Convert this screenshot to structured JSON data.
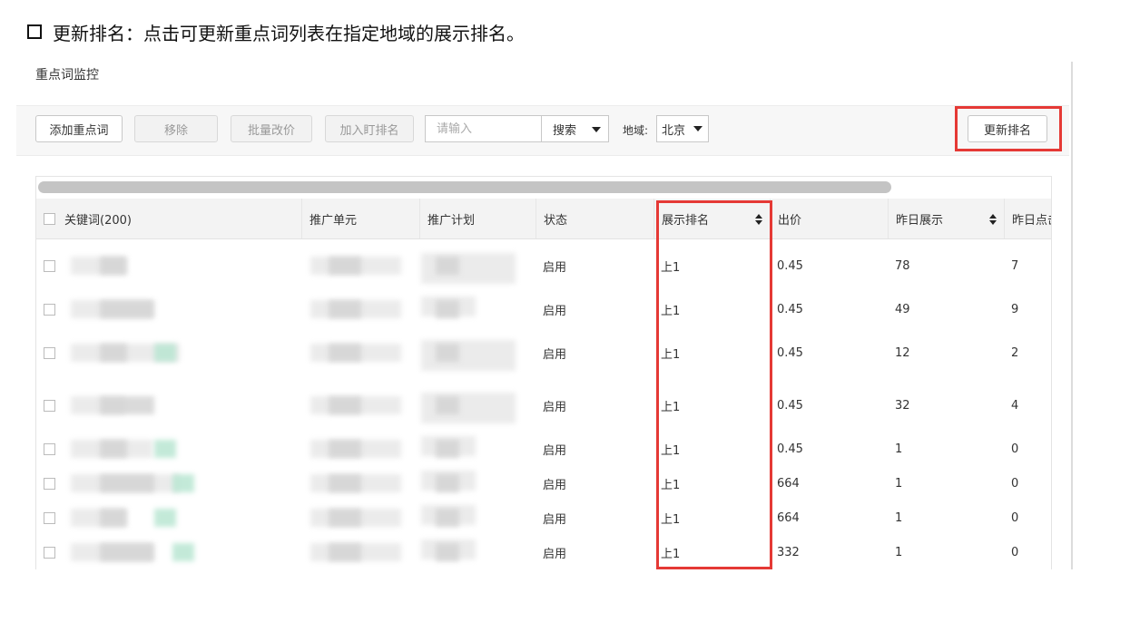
{
  "caption": "更新排名：点击可更新重点词列表在指定地域的展示排名。",
  "panel_title": "重点词监控",
  "toolbar": {
    "add_label": "添加重点词",
    "remove_label": "移除",
    "batch_price_label": "批量改价",
    "watch_rank_label": "加入盯排名",
    "search_placeholder": "请输入",
    "search_select": "搜索",
    "region_label": "地域:",
    "region_value": "北京",
    "update_label": "更新排名"
  },
  "table": {
    "columns": [
      "关键词(200)",
      "推广单元",
      "推广计划",
      "状态",
      "展示排名",
      "出价",
      "昨日展示",
      "昨日点击"
    ],
    "rows": [
      {
        "status": "启用",
        "rank": "上1",
        "price": "0.45",
        "impressions": "78",
        "clicks": "7"
      },
      {
        "status": "启用",
        "rank": "上1",
        "price": "0.45",
        "impressions": "49",
        "clicks": "9"
      },
      {
        "status": "启用",
        "rank": "上1",
        "price": "0.45",
        "impressions": "12",
        "clicks": "2"
      },
      {
        "status": "启用",
        "rank": "上1",
        "price": "0.45",
        "impressions": "32",
        "clicks": "4"
      },
      {
        "status": "启用",
        "rank": "上1",
        "price": "0.45",
        "impressions": "1",
        "clicks": "0"
      },
      {
        "status": "启用",
        "rank": "上1",
        "price": "664",
        "impressions": "1",
        "clicks": "0"
      },
      {
        "status": "启用",
        "rank": "上1",
        "price": "664",
        "impressions": "1",
        "clicks": "0"
      },
      {
        "status": "启用",
        "rank": "上1",
        "price": "332",
        "impressions": "1",
        "clicks": "0"
      }
    ]
  },
  "colors": {
    "highlight": "#e53935",
    "header_bg": "#f3f3f3",
    "scroll_thumb": "#c4c4c4"
  }
}
